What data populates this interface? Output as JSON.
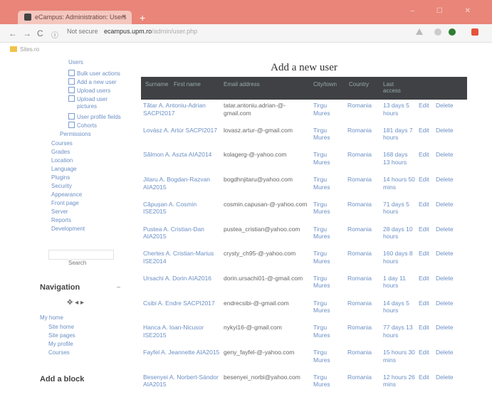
{
  "browser": {
    "tab_title": "eCampus: Administration: Users",
    "tab_close": "×",
    "new_tab": "+",
    "back": "←",
    "forward": "→",
    "reload": "C",
    "info": "ⓘ",
    "secure_label": "Not secure",
    "host": "ecampus.upm.ro",
    "path": "/admin/user.php",
    "bookmark_label": "Sites.ro",
    "window_controls": "–  ☐  ✕"
  },
  "sidebar": {
    "items_top": [
      "Users",
      "Bulk user actions",
      "Add a new user",
      "Upload users",
      "Upload user pictures",
      "User profile fields",
      "Cohorts",
      "Permissions"
    ],
    "items": [
      "Courses",
      "Grades",
      "Location",
      "Language",
      "Plugins",
      "Security",
      "Appearance",
      "Front page",
      "Server",
      "Reports",
      "Development"
    ],
    "search_button": "Search",
    "navigation_title": "Navigation",
    "nav_controls": "✥ ◂ ▸",
    "collapse": "–",
    "nav_items": [
      "My home",
      "Site home",
      "Site pages",
      "My profile",
      "Courses"
    ],
    "add_block_title": "Add a block"
  },
  "main": {
    "title": "Add a new user",
    "headers": [
      "Surname",
      "First name",
      "Email address",
      "City/town",
      "Country",
      "Last access"
    ],
    "rows": [
      {
        "name": "Tătar A. Antoniu-Adrian SACPI2017",
        "email": "tatar.antoniu.adrian-@-gmail.com",
        "city": "Tirgu Mures",
        "country": "Romania",
        "last": "13 days 5 hours",
        "edit": "Edit",
        "delete": "Delete"
      },
      {
        "name": "Lovász A. Artúr SACPI2017",
        "email": "lovasz.artur-@-gmail.com",
        "city": "Tirgu Mures",
        "country": "Romania",
        "last": "181 days 7 hours",
        "edit": "Edit",
        "delete": "Delete"
      },
      {
        "name": "Sălmon A. Aszta AIA2014",
        "email": "kolagerg-@-yahoo.com",
        "city": "Tirgu Mures",
        "country": "Romania",
        "last": "168 days 13 hours",
        "edit": "Edit",
        "delete": "Delete"
      },
      {
        "name": "Jitaru A. Bogdan-Razvan AIA2015",
        "email": "bogdhnjitaru@yahoo.com",
        "city": "Tirgu Mures",
        "country": "Romania",
        "last": "14 hours 50 mins",
        "edit": "Edit",
        "delete": "Delete"
      },
      {
        "name": "Căpușan A. Cosmin ISE2015",
        "email": "cosmin.capusan-@-yahoo.com",
        "city": "Tirgu Mures",
        "country": "Romania",
        "last": "71 days 5 hours",
        "edit": "Edit",
        "delete": "Delete"
      },
      {
        "name": "Pustea A. Cristian-Dan AIA2015",
        "email": "pustea_cristian@yahoo.com",
        "city": "Tirgu Mures",
        "country": "Romania",
        "last": "28 days 10 hours",
        "edit": "Edit",
        "delete": "Delete"
      },
      {
        "name": "Chertes A. Cristian-Marius ISE2014",
        "email": "crysty_ch95-@-yahoo.com",
        "city": "Tirgu Mures",
        "country": "Romania",
        "last": "160 days 8 hours",
        "edit": "Edit",
        "delete": "Delete"
      },
      {
        "name": "Ursachi A. Dorin AIA2016",
        "email": "dorin.ursachi01-@-gmail.com",
        "city": "Tirgu Mures",
        "country": "Romania",
        "last": "1 day 11 hours",
        "edit": "Edit",
        "delete": "Delete"
      },
      {
        "name": "Csibi A. Endre SACPI2017",
        "email": "endrecsibi-@-gmail.com",
        "city": "Tirgu Mures",
        "country": "Romania",
        "last": "14 days 5 hours",
        "edit": "Edit",
        "delete": "Delete"
      },
      {
        "name": "Hanca A. Ioan-Nicusor ISE2015",
        "email": "nykyi16-@-gmail.com",
        "city": "Tirgu Mures",
        "country": "Romania",
        "last": "77 days 13 hours",
        "edit": "Edit",
        "delete": "Delete"
      },
      {
        "name": "Fayfel A. Jeannette AIA2015",
        "email": "geny_fayfel-@-yahoo.com",
        "city": "Tirgu Mures",
        "country": "Romania",
        "last": "15 hours 30 mins",
        "edit": "Edit",
        "delete": "Delete"
      },
      {
        "name": "Besenyei A. Norbert-Sándor AIA2015",
        "email": "besenyei_norbi@yahoo.com",
        "city": "Tirgu Mures",
        "country": "Romania",
        "last": "12 hours 26 mins",
        "edit": "Edit",
        "delete": "Delete"
      }
    ]
  }
}
